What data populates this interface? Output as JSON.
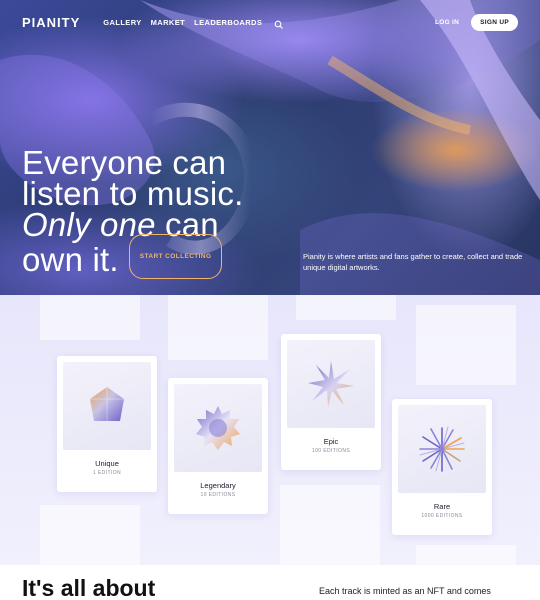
{
  "nav": {
    "logo": "PIANITY",
    "links": [
      "GALLERY",
      "MARKET",
      "LEADERBOARDS"
    ],
    "search_icon": "search-icon",
    "login": "LOG IN",
    "signup": "SIGN UP"
  },
  "hero": {
    "line1": "Everyone can",
    "line2": "listen to music.",
    "line3_italic": "Only one",
    "line3_rest": " can",
    "line4": "own it.",
    "cta": "START COLLECTING",
    "description": "Pianity is where artists and fans gather to create, collect and trade unique digital artworks."
  },
  "cards": [
    {
      "title": "Unique",
      "editions": "1 EDITION",
      "icon": "unique-gem-icon"
    },
    {
      "title": "Legendary",
      "editions": "10 EDITIONS",
      "icon": "legendary-badge-icon"
    },
    {
      "title": "Epic",
      "editions": "100 EDITIONS",
      "icon": "epic-star-icon"
    },
    {
      "title": "Rare",
      "editions": "1000 EDITIONS",
      "icon": "rare-burst-icon"
    }
  ],
  "section": {
    "heading": "It's all about",
    "text": "Each track is minted as an NFT and comes"
  },
  "colors": {
    "accent": "#f0b46a",
    "hero_dark": "#2b3a6e",
    "purple": "#8f7cf0"
  }
}
